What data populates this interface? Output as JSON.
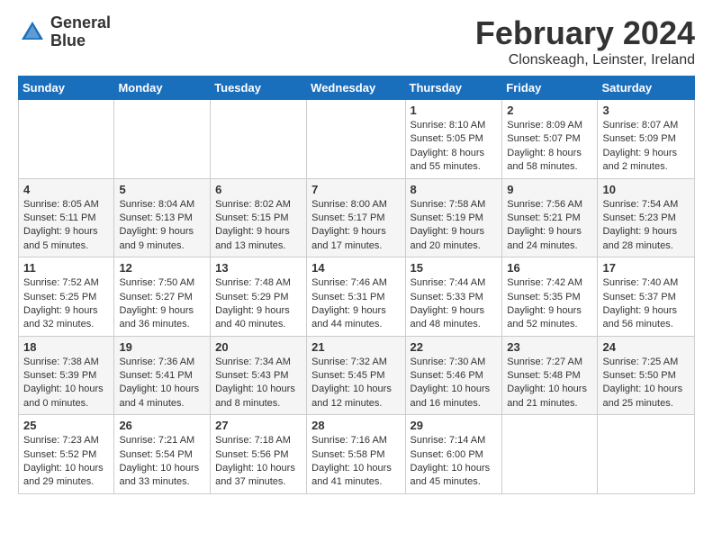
{
  "logo": {
    "line1": "General",
    "line2": "Blue"
  },
  "title": "February 2024",
  "subtitle": "Clonskeagh, Leinster, Ireland",
  "days_of_week": [
    "Sunday",
    "Monday",
    "Tuesday",
    "Wednesday",
    "Thursday",
    "Friday",
    "Saturday"
  ],
  "weeks": [
    [
      {
        "day": "",
        "info": ""
      },
      {
        "day": "",
        "info": ""
      },
      {
        "day": "",
        "info": ""
      },
      {
        "day": "",
        "info": ""
      },
      {
        "day": "1",
        "info": "Sunrise: 8:10 AM\nSunset: 5:05 PM\nDaylight: 8 hours\nand 55 minutes."
      },
      {
        "day": "2",
        "info": "Sunrise: 8:09 AM\nSunset: 5:07 PM\nDaylight: 8 hours\nand 58 minutes."
      },
      {
        "day": "3",
        "info": "Sunrise: 8:07 AM\nSunset: 5:09 PM\nDaylight: 9 hours\nand 2 minutes."
      }
    ],
    [
      {
        "day": "4",
        "info": "Sunrise: 8:05 AM\nSunset: 5:11 PM\nDaylight: 9 hours\nand 5 minutes."
      },
      {
        "day": "5",
        "info": "Sunrise: 8:04 AM\nSunset: 5:13 PM\nDaylight: 9 hours\nand 9 minutes."
      },
      {
        "day": "6",
        "info": "Sunrise: 8:02 AM\nSunset: 5:15 PM\nDaylight: 9 hours\nand 13 minutes."
      },
      {
        "day": "7",
        "info": "Sunrise: 8:00 AM\nSunset: 5:17 PM\nDaylight: 9 hours\nand 17 minutes."
      },
      {
        "day": "8",
        "info": "Sunrise: 7:58 AM\nSunset: 5:19 PM\nDaylight: 9 hours\nand 20 minutes."
      },
      {
        "day": "9",
        "info": "Sunrise: 7:56 AM\nSunset: 5:21 PM\nDaylight: 9 hours\nand 24 minutes."
      },
      {
        "day": "10",
        "info": "Sunrise: 7:54 AM\nSunset: 5:23 PM\nDaylight: 9 hours\nand 28 minutes."
      }
    ],
    [
      {
        "day": "11",
        "info": "Sunrise: 7:52 AM\nSunset: 5:25 PM\nDaylight: 9 hours\nand 32 minutes."
      },
      {
        "day": "12",
        "info": "Sunrise: 7:50 AM\nSunset: 5:27 PM\nDaylight: 9 hours\nand 36 minutes."
      },
      {
        "day": "13",
        "info": "Sunrise: 7:48 AM\nSunset: 5:29 PM\nDaylight: 9 hours\nand 40 minutes."
      },
      {
        "day": "14",
        "info": "Sunrise: 7:46 AM\nSunset: 5:31 PM\nDaylight: 9 hours\nand 44 minutes."
      },
      {
        "day": "15",
        "info": "Sunrise: 7:44 AM\nSunset: 5:33 PM\nDaylight: 9 hours\nand 48 minutes."
      },
      {
        "day": "16",
        "info": "Sunrise: 7:42 AM\nSunset: 5:35 PM\nDaylight: 9 hours\nand 52 minutes."
      },
      {
        "day": "17",
        "info": "Sunrise: 7:40 AM\nSunset: 5:37 PM\nDaylight: 9 hours\nand 56 minutes."
      }
    ],
    [
      {
        "day": "18",
        "info": "Sunrise: 7:38 AM\nSunset: 5:39 PM\nDaylight: 10 hours\nand 0 minutes."
      },
      {
        "day": "19",
        "info": "Sunrise: 7:36 AM\nSunset: 5:41 PM\nDaylight: 10 hours\nand 4 minutes."
      },
      {
        "day": "20",
        "info": "Sunrise: 7:34 AM\nSunset: 5:43 PM\nDaylight: 10 hours\nand 8 minutes."
      },
      {
        "day": "21",
        "info": "Sunrise: 7:32 AM\nSunset: 5:45 PM\nDaylight: 10 hours\nand 12 minutes."
      },
      {
        "day": "22",
        "info": "Sunrise: 7:30 AM\nSunset: 5:46 PM\nDaylight: 10 hours\nand 16 minutes."
      },
      {
        "day": "23",
        "info": "Sunrise: 7:27 AM\nSunset: 5:48 PM\nDaylight: 10 hours\nand 21 minutes."
      },
      {
        "day": "24",
        "info": "Sunrise: 7:25 AM\nSunset: 5:50 PM\nDaylight: 10 hours\nand 25 minutes."
      }
    ],
    [
      {
        "day": "25",
        "info": "Sunrise: 7:23 AM\nSunset: 5:52 PM\nDaylight: 10 hours\nand 29 minutes."
      },
      {
        "day": "26",
        "info": "Sunrise: 7:21 AM\nSunset: 5:54 PM\nDaylight: 10 hours\nand 33 minutes."
      },
      {
        "day": "27",
        "info": "Sunrise: 7:18 AM\nSunset: 5:56 PM\nDaylight: 10 hours\nand 37 minutes."
      },
      {
        "day": "28",
        "info": "Sunrise: 7:16 AM\nSunset: 5:58 PM\nDaylight: 10 hours\nand 41 minutes."
      },
      {
        "day": "29",
        "info": "Sunrise: 7:14 AM\nSunset: 6:00 PM\nDaylight: 10 hours\nand 45 minutes."
      },
      {
        "day": "",
        "info": ""
      },
      {
        "day": "",
        "info": ""
      }
    ]
  ]
}
